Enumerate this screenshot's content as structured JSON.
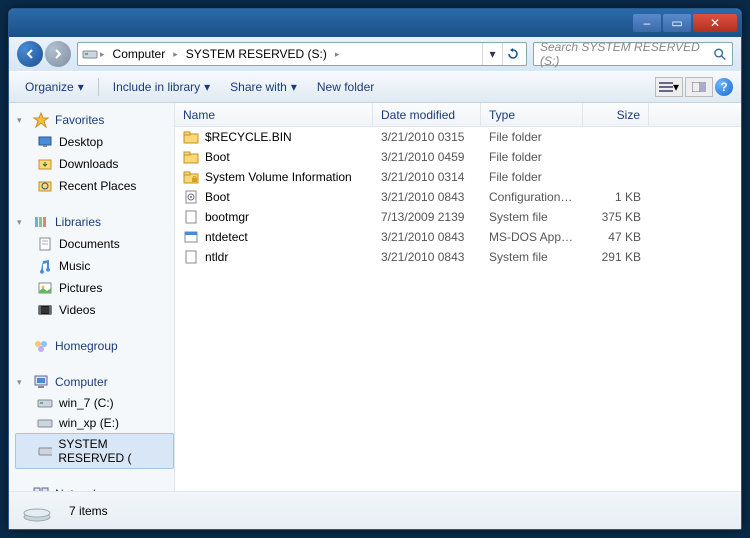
{
  "titlebar": {
    "min": "–",
    "max": "▭",
    "close": "✕"
  },
  "breadcrumbs": [
    "Computer",
    "SYSTEM RESERVED (S:)"
  ],
  "search": {
    "placeholder": "Search SYSTEM RESERVED (S:)"
  },
  "toolbar": {
    "organize": "Organize",
    "include": "Include in library",
    "share": "Share with",
    "newfolder": "New folder"
  },
  "nav": {
    "favorites": {
      "label": "Favorites",
      "items": [
        "Desktop",
        "Downloads",
        "Recent Places"
      ]
    },
    "libraries": {
      "label": "Libraries",
      "items": [
        "Documents",
        "Music",
        "Pictures",
        "Videos"
      ]
    },
    "homegroup": {
      "label": "Homegroup"
    },
    "computer": {
      "label": "Computer",
      "items": [
        "win_7 (C:)",
        "win_xp (E:)",
        "SYSTEM RESERVED ("
      ]
    },
    "network": {
      "label": "Network"
    }
  },
  "columns": {
    "name": "Name",
    "date": "Date modified",
    "type": "Type",
    "size": "Size"
  },
  "files": [
    {
      "icon": "folder",
      "name": "$RECYCLE.BIN",
      "date": "3/21/2010 0315",
      "type": "File folder",
      "size": ""
    },
    {
      "icon": "folder",
      "name": "Boot",
      "date": "3/21/2010 0459",
      "type": "File folder",
      "size": ""
    },
    {
      "icon": "folder-lock",
      "name": "System Volume Information",
      "date": "3/21/2010 0314",
      "type": "File folder",
      "size": ""
    },
    {
      "icon": "cfg",
      "name": "Boot",
      "date": "3/21/2010 0843",
      "type": "Configuration sett...",
      "size": "1 KB"
    },
    {
      "icon": "file",
      "name": "bootmgr",
      "date": "7/13/2009 2139",
      "type": "System file",
      "size": "375 KB"
    },
    {
      "icon": "app",
      "name": "ntdetect",
      "date": "3/21/2010 0843",
      "type": "MS-DOS Applicati...",
      "size": "47 KB"
    },
    {
      "icon": "file",
      "name": "ntldr",
      "date": "3/21/2010 0843",
      "type": "System file",
      "size": "291 KB"
    }
  ],
  "status": {
    "count": "7 items"
  }
}
